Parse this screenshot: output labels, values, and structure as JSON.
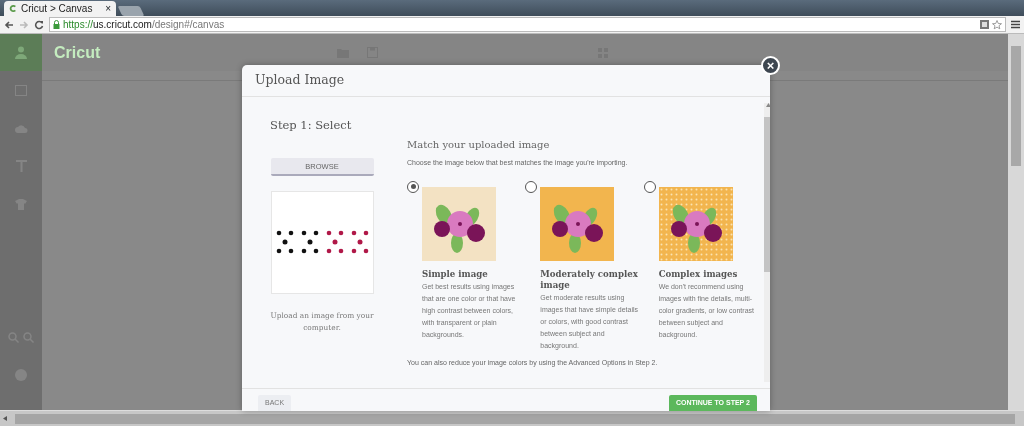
{
  "browser": {
    "tab_title": "Cricut > Canvas",
    "tab_close": "×",
    "url": {
      "scheme": "https://",
      "host": "us.cricut.com",
      "path": "/design#/canvas"
    }
  },
  "app": {
    "logo": "Cricut"
  },
  "dialog": {
    "title": "Upload Image",
    "close": "×",
    "step": "Step 1: Select",
    "browse": "BROWSE",
    "upload_hint": "Upload an image from your computer.",
    "match_heading": "Match your uploaded image",
    "match_subtitle": "Choose the image below that best matches the image you're importing.",
    "options": [
      {
        "kind": "plain",
        "selected": true,
        "title": "Simple image",
        "description": "Get best results using images that are one color or that have high contrast between colors, with transparent or plain backgrounds."
      },
      {
        "kind": "solid",
        "selected": false,
        "title": "Moderately complex image",
        "description": "Get moderate results using images that have simple details or colors, with good contrast between subject and background."
      },
      {
        "kind": "dotted",
        "selected": false,
        "title": "Complex images",
        "description": "We don't recommend using images with fine details, multi-color gradients, or low contrast between subject and background."
      }
    ],
    "note": "You can also reduce your image colors by using the Advanced Options in Step 2.",
    "back": "BACK",
    "continue": "CONTINUE TO STEP 2"
  }
}
